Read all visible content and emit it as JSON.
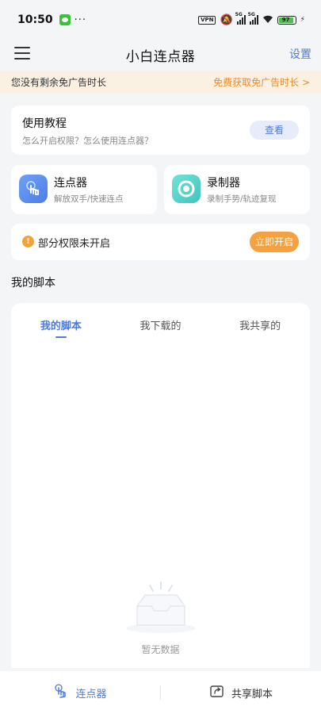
{
  "status_bar": {
    "time": "10:50",
    "more": "···",
    "vpn": "VPN",
    "network1": "5G",
    "network2": "5G",
    "battery": "97"
  },
  "header": {
    "title": "小白连点器",
    "settings_label": "设置"
  },
  "ad_banner": {
    "message": "您没有剩余免广告时长",
    "link": "免费获取免广告时长 >"
  },
  "tutorial": {
    "title": "使用教程",
    "subtitle": "怎么开启权限？怎么使用连点器？",
    "button": "查看"
  },
  "features": [
    {
      "title": "连点器",
      "subtitle": "解放双手/快速连点",
      "icon": "tap-hand-icon"
    },
    {
      "title": "录制器",
      "subtitle": "录制手势/轨迹复现",
      "icon": "record-icon"
    }
  ],
  "permission": {
    "message": "部分权限未开启",
    "button": "立即开启",
    "icon_glyph": "!"
  },
  "my_scripts": {
    "section_title": "我的脚本",
    "tabs": [
      {
        "label": "我的脚本",
        "active": true
      },
      {
        "label": "我下载的",
        "active": false
      },
      {
        "label": "我共享的",
        "active": false
      }
    ],
    "empty_text": "暂无数据"
  },
  "bottom_nav": {
    "items": [
      {
        "label": "连点器",
        "icon": "tap-hand-icon",
        "active": true
      },
      {
        "label": "共享脚本",
        "icon": "share-icon",
        "active": false
      }
    ]
  },
  "colors": {
    "accent": "#4f7bd8",
    "warning": "#f3a141",
    "banner_bg": "#fbf1e3"
  }
}
